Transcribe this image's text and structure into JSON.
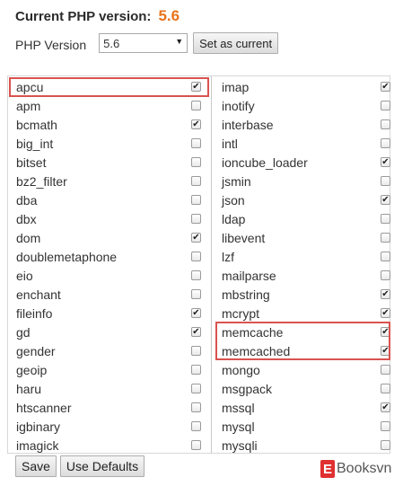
{
  "header": {
    "label": "Current PHP version:",
    "version": "5.6"
  },
  "selector": {
    "label": "PHP Version",
    "selected": "5.6",
    "button": "Set as current"
  },
  "left_column": [
    {
      "name": "apcu",
      "checked": true
    },
    {
      "name": "apm",
      "checked": false
    },
    {
      "name": "bcmath",
      "checked": true
    },
    {
      "name": "big_int",
      "checked": false
    },
    {
      "name": "bitset",
      "checked": false
    },
    {
      "name": "bz2_filter",
      "checked": false
    },
    {
      "name": "dba",
      "checked": false
    },
    {
      "name": "dbx",
      "checked": false
    },
    {
      "name": "dom",
      "checked": true
    },
    {
      "name": "doublemetaphone",
      "checked": false
    },
    {
      "name": "eio",
      "checked": false
    },
    {
      "name": "enchant",
      "checked": false
    },
    {
      "name": "fileinfo",
      "checked": true
    },
    {
      "name": "gd",
      "checked": true
    },
    {
      "name": "gender",
      "checked": false
    },
    {
      "name": "geoip",
      "checked": false
    },
    {
      "name": "haru",
      "checked": false
    },
    {
      "name": "htscanner",
      "checked": false
    },
    {
      "name": "igbinary",
      "checked": false
    },
    {
      "name": "imagick",
      "checked": false
    }
  ],
  "right_column": [
    {
      "name": "imap",
      "checked": true
    },
    {
      "name": "inotify",
      "checked": false
    },
    {
      "name": "interbase",
      "checked": false
    },
    {
      "name": "intl",
      "checked": false
    },
    {
      "name": "ioncube_loader",
      "checked": true
    },
    {
      "name": "jsmin",
      "checked": false
    },
    {
      "name": "json",
      "checked": true
    },
    {
      "name": "ldap",
      "checked": false
    },
    {
      "name": "libevent",
      "checked": false
    },
    {
      "name": "lzf",
      "checked": false
    },
    {
      "name": "mailparse",
      "checked": false
    },
    {
      "name": "mbstring",
      "checked": true
    },
    {
      "name": "mcrypt",
      "checked": true
    },
    {
      "name": "memcache",
      "checked": true
    },
    {
      "name": "memcached",
      "checked": true
    },
    {
      "name": "mongo",
      "checked": false
    },
    {
      "name": "msgpack",
      "checked": false
    },
    {
      "name": "mssql",
      "checked": true
    },
    {
      "name": "mysql",
      "checked": false
    },
    {
      "name": "mysqli",
      "checked": false
    }
  ],
  "footer": {
    "save": "Save",
    "use_defaults": "Use Defaults"
  },
  "logo": {
    "badge": "E",
    "text": "Booksvn"
  },
  "colors": {
    "version": "#e8731a",
    "highlight": "#d9534f",
    "logo": "#e03030"
  }
}
